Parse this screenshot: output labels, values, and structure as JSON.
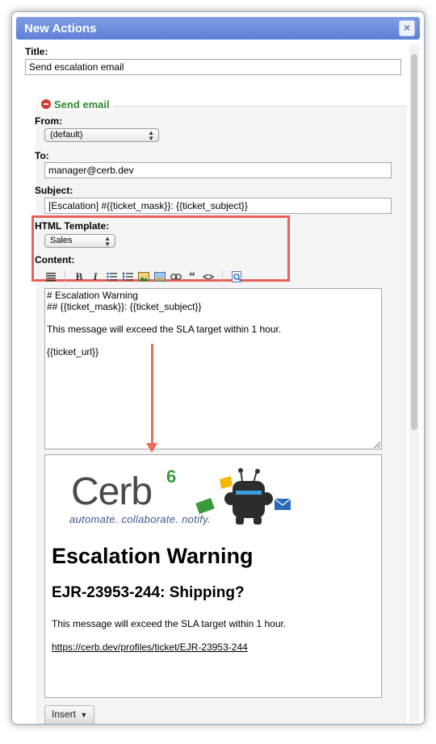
{
  "dialog": {
    "title": "New Actions",
    "close_icon": "close-icon"
  },
  "form": {
    "title_label": "Title:",
    "title_value": "Send escalation email"
  },
  "send_email": {
    "header": "Send email",
    "header_icon": "remove-icon",
    "from_label": "From:",
    "from_value": "(default)",
    "to_label": "To:",
    "to_value": "manager@cerb.dev",
    "subject_label": "Subject:",
    "subject_value": "[Escalation] #{{ticket_mask}}: {{ticket_subject}}",
    "template_label": "HTML Template:",
    "template_value": "Sales",
    "content_label": "Content:"
  },
  "toolbar": {
    "icons": [
      "paragraph-icon",
      "bold-icon",
      "italic-icon",
      "bulleted-list-icon",
      "numbered-list-icon",
      "image-icon",
      "image-link-icon",
      "link-icon",
      "quote-icon",
      "code-icon",
      "preview-icon"
    ]
  },
  "editor": {
    "lines": [
      "# Escalation Warning",
      "## {{ticket_mask}}: {{ticket_subject}}",
      "",
      "This message will exceed the SLA target within 1 hour.",
      "",
      "{{ticket_url}}"
    ]
  },
  "preview": {
    "logo_text": "Cerb",
    "logo_version": "6",
    "tagline": "automate. collaborate. notify.",
    "h1": "Escalation Warning",
    "h2": "EJR-23953-244: Shipping?",
    "paragraph": "This message will exceed the SLA target within 1 hour.",
    "link": "https://cerb.dev/profiles/ticket/EJR-23953-244"
  },
  "insert_button": "Insert",
  "colors": {
    "titlebar": "#6c8be0",
    "highlight": "#e8605a",
    "section_header": "#2e8b2e",
    "logo_green": "#3a9a3a"
  }
}
